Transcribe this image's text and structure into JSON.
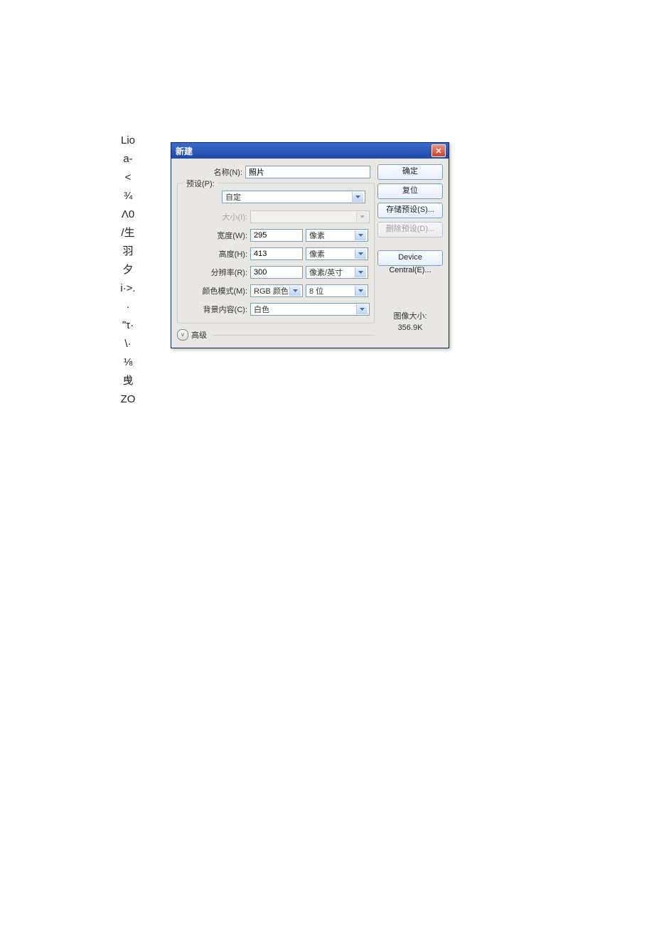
{
  "side_text": [
    "Lio",
    "a-",
    "<",
    "¾",
    "Λ0",
    "/生",
    "羽",
    "夕",
    "i·>.",
    "·",
    "\"τ·",
    "\\·",
    "⅛",
    "曵",
    "ZO"
  ],
  "dialog": {
    "title": "新建",
    "close_icon": "✕",
    "buttons": {
      "ok": "确定",
      "reset": "复位",
      "save_preset": "存储预设(S)...",
      "delete_preset": "删除预设(D)...",
      "device_central": "Device Central(E)..."
    },
    "labels": {
      "name": "名称(N):",
      "preset": "预设(P):",
      "size": "大小(I):",
      "width": "宽度(W):",
      "height": "高度(H):",
      "resolution": "分辨率(R):",
      "color_mode": "颜色模式(M):",
      "bg_content": "背景内容(C):",
      "advanced": "高级"
    },
    "values": {
      "name": "照片",
      "preset": "自定",
      "size": "",
      "width": "295",
      "width_unit": "像素",
      "height": "413",
      "height_unit": "像素",
      "resolution": "300",
      "resolution_unit": "像素/英寸",
      "color_mode": "RGB 颜色",
      "bit_depth": "8 位",
      "bg_content": "白色"
    },
    "image_size": {
      "label": "图像大小:",
      "value": "356.9K"
    },
    "adv_toggle": "˅"
  }
}
